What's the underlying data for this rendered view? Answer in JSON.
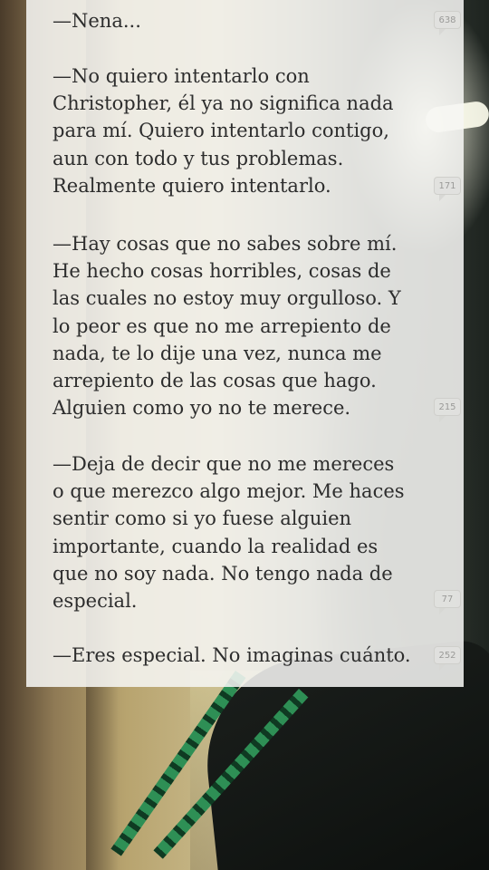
{
  "passages": [
    "—Nena...",
    "—No quiero intentarlo con\nChristopher, él ya no significa nada\npara mí. Quiero intentarlo contigo,\naun con todo y tus problemas.\nRealmente quiero intentarlo.",
    "—Hay cosas que no sabes sobre mí.\nHe hecho cosas horribles, cosas de\nlas cuales no estoy muy orgulloso. Y\nlo peor es que no me arrepiento de\nnada, te lo dije una vez, nunca me\narrepiento de las cosas que hago.\nAlguien como yo no te merece.",
    "—Deja de decir que no me mereces\no que merezco algo mejor. Me haces\nsentir como si yo fuese alguien\nimportante, cuando la realidad es\nque no soy nada. No tengo nada de\nespecial.",
    "—Eres especial. No imaginas cuánto."
  ],
  "comment_counts": [
    "638",
    "171",
    "215",
    "77",
    "252"
  ]
}
